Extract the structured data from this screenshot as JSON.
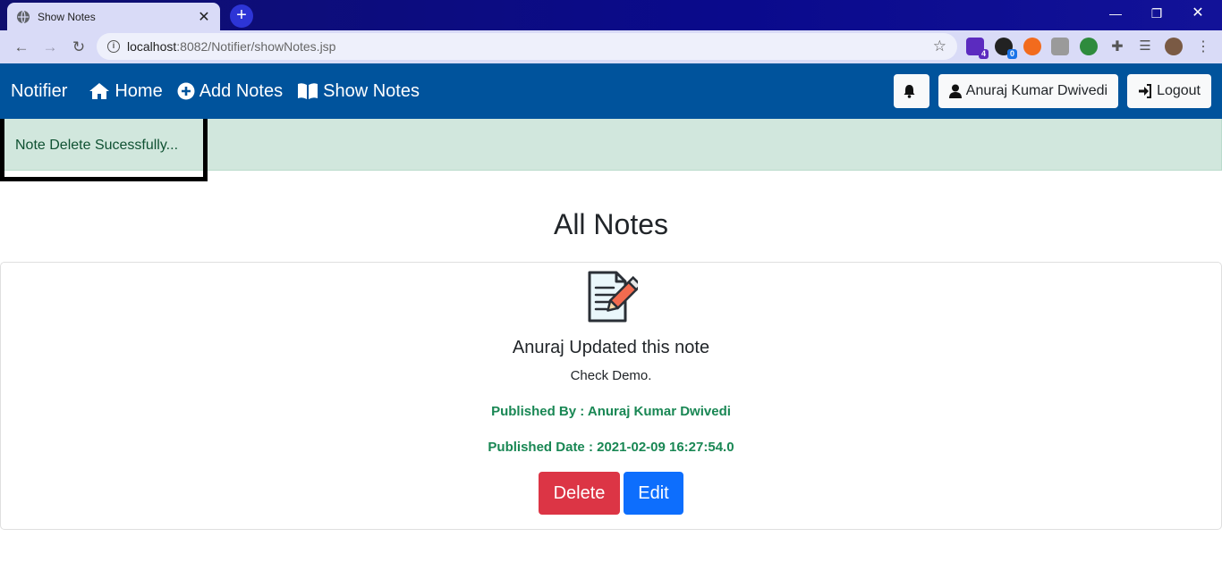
{
  "browser": {
    "tab_title": "Show Notes",
    "url_host": "localhost",
    "url_path": ":8082/Notifier/showNotes.jsp",
    "extensions": [
      {
        "name": "extension-1",
        "badge": "4",
        "color": "#5b2bbf"
      },
      {
        "name": "extension-2",
        "badge": "0",
        "color": "#222222"
      },
      {
        "name": "extension-3",
        "badge": "",
        "color": "#f26b1d"
      },
      {
        "name": "extension-4",
        "badge": "",
        "color": "#9a9a9a"
      },
      {
        "name": "extension-5",
        "badge": "",
        "color": "#2e8b3d"
      }
    ]
  },
  "navbar": {
    "brand": "Notifier",
    "links": [
      {
        "label": "Home",
        "icon": "home-icon"
      },
      {
        "label": "Add Notes",
        "icon": "plus-circle-icon"
      },
      {
        "label": "Show Notes",
        "icon": "book-icon"
      }
    ],
    "user_label": "Anuraj Kumar Dwivedi",
    "logout_label": "Logout"
  },
  "alert": {
    "message": "Note Delete Sucessfully..."
  },
  "page": {
    "title": "All Notes"
  },
  "note": {
    "title": "Anuraj Updated this note",
    "content": "Check Demo.",
    "published_by": "Published By : Anuraj Kumar Dwivedi",
    "published_date": "Published Date : 2021-02-09 16:27:54.0",
    "delete_label": "Delete",
    "edit_label": "Edit"
  },
  "colors": {
    "navbar_bg": "#00539c",
    "alert_bg": "#d1e7dd",
    "delete_bg": "#dc3545",
    "edit_bg": "#0d6efd",
    "published_text": "#198754"
  }
}
